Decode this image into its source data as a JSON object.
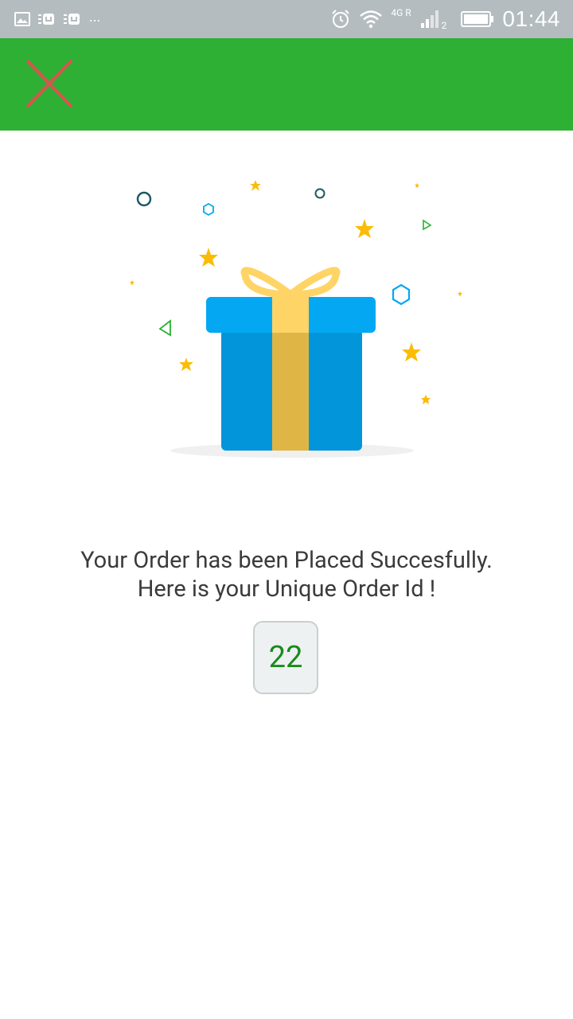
{
  "status_bar": {
    "left_icons": [
      "gallery-icon",
      "app-icon",
      "app-icon",
      "more-dots-icon"
    ],
    "overflow": "...",
    "network_label": "4G R",
    "sim_slot": "2",
    "time": "01:44"
  },
  "app_bar": {
    "close_icon": "close-icon",
    "colors": {
      "background": "#2db034",
      "close": "#d9534f"
    }
  },
  "illustration": {
    "name": "gift-icon",
    "colors": {
      "box": "#0395da",
      "lid": "#04a8f2",
      "ribbon": "#ffd466",
      "star": "#fbbc05",
      "shadow": "#f0f0f0"
    }
  },
  "message": {
    "line1": "Your Order has been Placed Succesfully.",
    "line2": "Here is your Unique Order Id !"
  },
  "order": {
    "id": "22",
    "color": "#1a8a1a"
  }
}
